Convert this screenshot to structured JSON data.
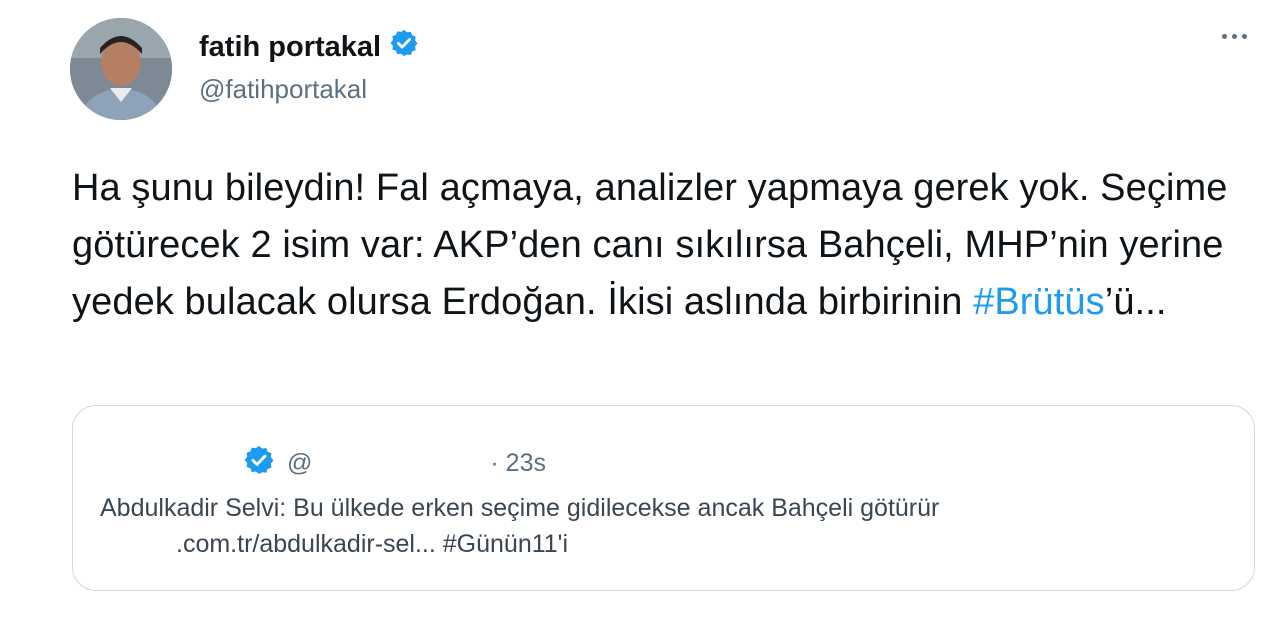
{
  "author": {
    "display_name": "fatih portakal",
    "handle": "@fatihportakal",
    "avatar_icon": "profile-photo",
    "verified_icon": "verified-badge-icon"
  },
  "menu": {
    "more_icon": "more-options-icon"
  },
  "tweet": {
    "text_before": "Ha şunu bileydin! Fal açmaya, analizler yapmaya gerek yok. Seçime götürecek 2 isim var: AKP’den canı sıkılırsa Bahçeli, MHP’nin yerine yedek bulacak olursa Erdoğan. İkisi aslında birbirinin ",
    "hashtag": "#Brütüs",
    "text_after": "’ü..."
  },
  "quoted_tweet": {
    "handle": "@",
    "time": "· 23s",
    "line1": "Abdulkadir Selvi: Bu ülkede erken seçime gidilecekse ancak Bahçeli götürür",
    "line2": ".com.tr/abdulkadir-sel... #Günün11'i"
  },
  "colors": {
    "link": "#1d9bf0",
    "secondary_text": "#5b7083",
    "border": "#cfd9de"
  }
}
